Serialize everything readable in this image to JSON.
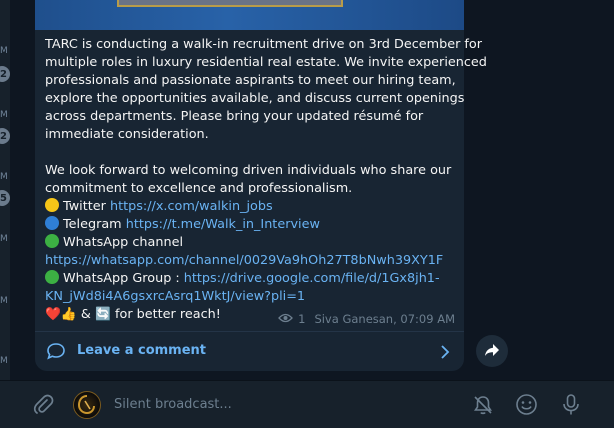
{
  "message": {
    "lines": [
      [
        {
          "t": "TARC is conducting a walk-in recruitment drive on 3rd December for"
        }
      ],
      [
        {
          "t": "multiple roles in luxury residential real estate. We invite experienced"
        }
      ],
      [
        {
          "t": "professionals and passionate aspirants to meet our hiring team,"
        }
      ],
      [
        {
          "t": "explore the opportunities available, and discuss current openings"
        }
      ],
      [
        {
          "t": "across departments. Please bring your updated résumé for"
        }
      ],
      [
        {
          "t": "immediate consideration."
        }
      ],
      [],
      [
        {
          "t": "We look forward to welcoming driven individuals who share our"
        }
      ],
      [
        {
          "t": "commitment to excellence and professionalism."
        }
      ],
      [
        {
          "e": "#f5c518"
        },
        {
          "t": "Twitter "
        },
        {
          "l": "https://x.com/walkin_jobs"
        }
      ],
      [
        {
          "e": "#2f7fd6"
        },
        {
          "t": "Telegram  "
        },
        {
          "l": "https://t.me/Walk_in_Interview"
        }
      ],
      [
        {
          "e": "#3cb043"
        },
        {
          "t": "WhatsApp channel"
        }
      ],
      [
        {
          "l": "https://whatsapp.com/channel/0029Va9hOh27T8bNwh39XY1F"
        }
      ],
      [
        {
          "e": "#3cb043"
        },
        {
          "t": "WhatsApp Group : "
        },
        {
          "l": "https://drive.google.com/file/d/1Gx8jh1-"
        }
      ],
      [
        {
          "l": "KN_jWd8i4A6gsxrcAsrq1WktJ/view?pli=1"
        }
      ],
      [
        {
          "t": "❤️👍 & 🔄 for better reach!"
        }
      ]
    ],
    "views": "1",
    "author_time": "Siva Ganesan, 07:09 AM"
  },
  "comments": {
    "label": "Leave a comment"
  },
  "composer": {
    "placeholder": "Silent broadcast..."
  },
  "left_strip": {
    "marks": [
      "M",
      "M",
      "M",
      "M",
      "M",
      "M",
      "M"
    ],
    "badges": [
      "2",
      "2",
      "5"
    ]
  },
  "colors": {
    "bubble": "#182533",
    "link": "#6ab3f3",
    "background": "#0e1621",
    "panel": "#17212b"
  }
}
